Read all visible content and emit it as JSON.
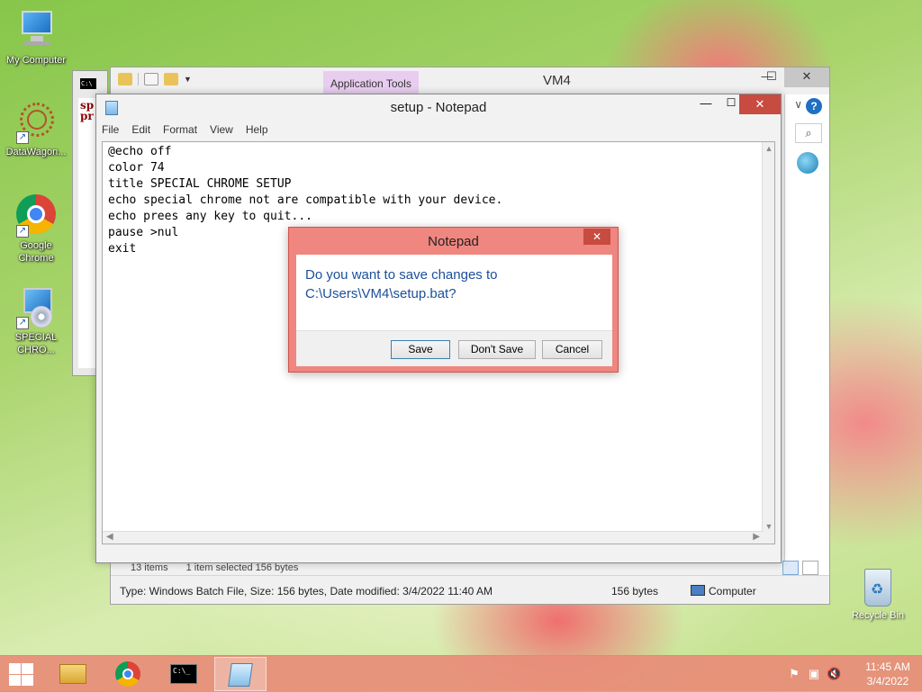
{
  "desktop": {
    "icons": [
      {
        "label": "My Computer"
      },
      {
        "label": "DataWagon..."
      },
      {
        "label": "Google Chrome"
      },
      {
        "label": "SPECIAL CHRO..."
      }
    ],
    "recycle_bin": "Recycle Bin"
  },
  "cmd_window": {
    "icon_text": "C:\\",
    "content": "sp\npr"
  },
  "explorer": {
    "contextual_tab": "Application Tools",
    "title": "VM4",
    "status_items": "13 items",
    "status_selected": "1 item selected  156 bytes",
    "status_detail": "Type: Windows Batch File, Size: 156 bytes, Date modified: 3/4/2022 11:40 AM",
    "status_size": "156 bytes",
    "status_location": "Computer"
  },
  "notepad": {
    "title": "setup - Notepad",
    "menu": [
      "File",
      "Edit",
      "Format",
      "View",
      "Help"
    ],
    "content": "@echo off\ncolor 74\ntitle SPECIAL CHROME SETUP\necho special chrome not are compatible with your device.\necho prees any key to quit...\npause >nul\nexit"
  },
  "dialog": {
    "title": "Notepad",
    "message_line1": "Do you want to save changes to",
    "message_line2": "C:\\Users\\VM4\\setup.bat?",
    "buttons": {
      "save": "Save",
      "dont_save": "Don't Save",
      "cancel": "Cancel"
    }
  },
  "taskbar": {
    "time": "11:45 AM",
    "date": "3/4/2022",
    "colors": {
      "accent": "#e88c78"
    }
  }
}
